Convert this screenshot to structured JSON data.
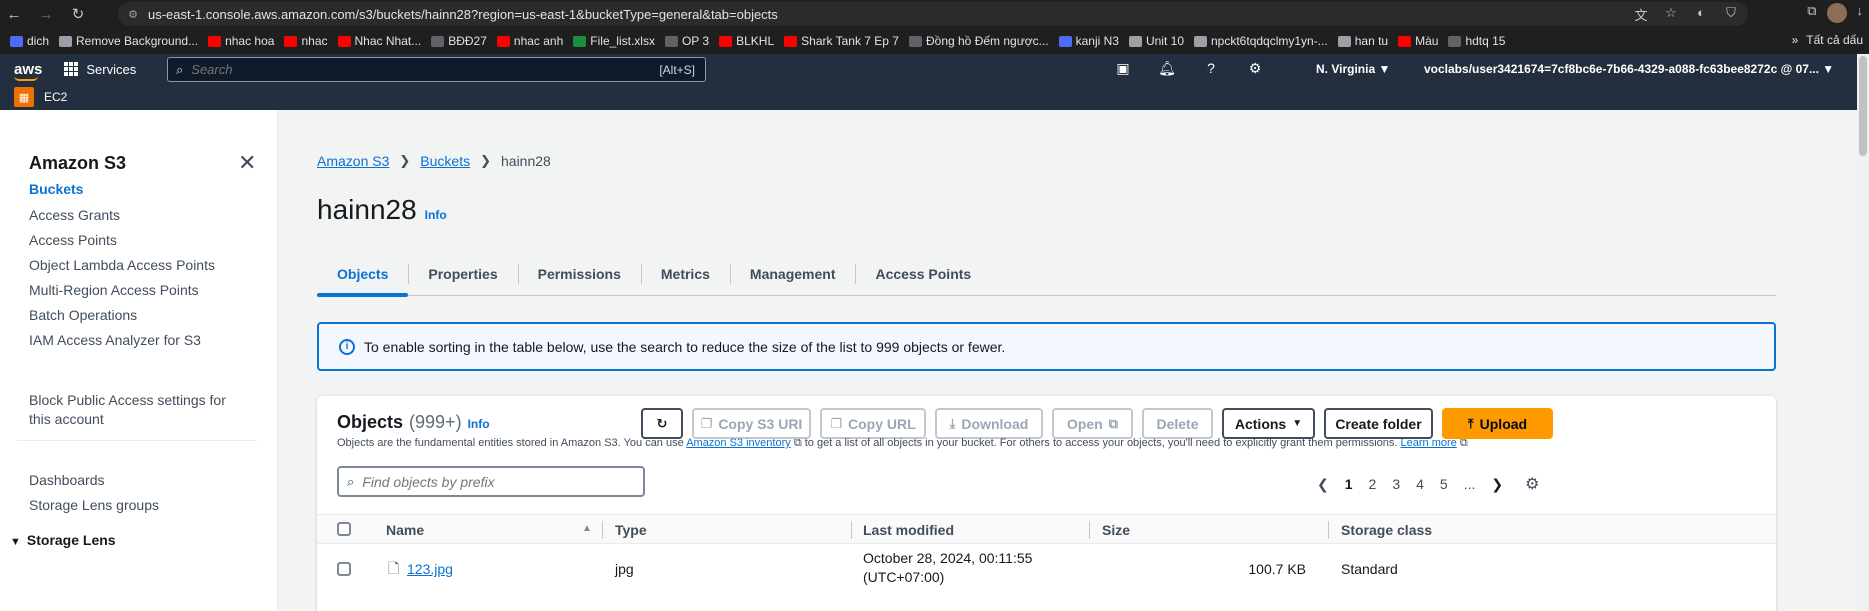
{
  "browser": {
    "url": "us-east-1.console.aws.amazon.com/s3/buckets/hainn28?region=us-east-1&bucketType=general&tab=objects",
    "bookmarks": [
      {
        "label": "dich",
        "icon": "translate-icon"
      },
      {
        "label": "Remove Background...",
        "icon": "image-icon"
      },
      {
        "label": "nhac hoa",
        "icon": "youtube-icon"
      },
      {
        "label": "nhac",
        "icon": "youtube-icon"
      },
      {
        "label": "Nhac Nhat...",
        "icon": "youtube-icon"
      },
      {
        "label": "BĐĐ27",
        "icon": "tiktok-icon"
      },
      {
        "label": "nhac anh",
        "icon": "youtube-icon"
      },
      {
        "label": "File_list.xlsx",
        "icon": "excel-icon"
      },
      {
        "label": "OP 3",
        "icon": "tiktok-icon"
      },
      {
        "label": "BLKHL",
        "icon": "youtube-icon"
      },
      {
        "label": "Shark Tank 7 Ep 7",
        "icon": "youtube-icon"
      },
      {
        "label": "Đồng hồ Đếm ngược...",
        "icon": "clock-icon"
      },
      {
        "label": "kanji N3",
        "icon": "circle-icon"
      },
      {
        "label": "Unit 10",
        "icon": "globe-icon"
      },
      {
        "label": "npckt6tqdqclmy1yn-...",
        "icon": "globe-icon"
      },
      {
        "label": "han tu",
        "icon": "image-icon"
      },
      {
        "label": "Màu",
        "icon": "color-icon"
      },
      {
        "label": "hdtq 15",
        "icon": "tiktok-icon"
      }
    ],
    "bookmarks_overflow": "»",
    "all_bookmarks": "Tất cả dấu"
  },
  "aws": {
    "logo": "aws",
    "services": "Services",
    "search_placeholder": "Search",
    "search_shortcut": "[Alt+S]",
    "region": "N. Virginia ▼",
    "account": "voclabs/user3421674=7cf8bc6e-7b66-4329-a088-fc63bee8272c @ 07... ▼",
    "favorite_service": "EC2"
  },
  "sidebar": {
    "title": "Amazon S3",
    "items": [
      {
        "label": "Buckets",
        "active": true
      },
      {
        "label": "Access Grants"
      },
      {
        "label": "Access Points"
      },
      {
        "label": "Object Lambda Access Points"
      },
      {
        "label": "Multi-Region Access Points"
      },
      {
        "label": "Batch Operations"
      },
      {
        "label": "IAM Access Analyzer for S3"
      }
    ],
    "block_public_line1": "Block Public Access settings for",
    "block_public_line2": "this account",
    "storage_lens": "Storage Lens",
    "storage_lens_items": [
      "Dashboards",
      "Storage Lens groups"
    ]
  },
  "main": {
    "breadcrumbs": [
      "Amazon S3",
      "Buckets",
      "hainn28"
    ],
    "title": "hainn28",
    "info": "Info",
    "tabs": [
      "Objects",
      "Properties",
      "Permissions",
      "Metrics",
      "Management",
      "Access Points"
    ],
    "alert": "To enable sorting in the table below, use the search to reduce the size of the list to 999 objects or fewer."
  },
  "objects": {
    "heading": "Objects",
    "count": "(999+)",
    "info": "Info",
    "desc_before": "Objects are the fundamental entities stored in Amazon S3. You can use",
    "desc_link1": "Amazon S3 inventory",
    "desc_middle": "to get a list of all objects in your bucket. For others to access your objects, you'll need to explicitly grant them permissions.",
    "desc_link2": "Learn more",
    "buttons": {
      "copy_uri": "Copy S3 URI",
      "copy_url": "Copy URL",
      "download": "Download",
      "open": "Open",
      "delete": "Delete",
      "actions": "Actions",
      "create_folder": "Create folder",
      "upload": "Upload"
    },
    "filter_placeholder": "Find objects by prefix",
    "pages": [
      "1",
      "2",
      "3",
      "4",
      "5",
      "..."
    ],
    "columns": [
      "Name",
      "Type",
      "Last modified",
      "Size",
      "Storage class"
    ],
    "rows": [
      {
        "name": "123.jpg",
        "type": "jpg",
        "modified_line1": "October 28, 2024, 00:11:55",
        "modified_line2": "(UTC+07:00)",
        "size": "100.7 KB",
        "storage_class": "Standard"
      }
    ]
  },
  "colors": {
    "accent": "#0972d3",
    "primary_button": "#ff9900",
    "nav": "#232f3e"
  }
}
